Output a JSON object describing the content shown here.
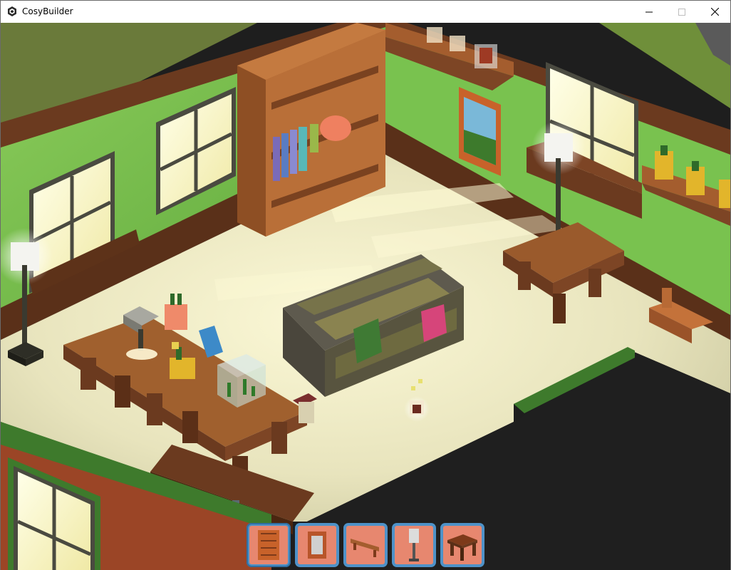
{
  "window": {
    "title": "CosyBuilder",
    "app_icon": "cube-icon",
    "controls": {
      "minimize": "minimize-icon",
      "maximize": "maximize-icon",
      "close": "close-icon"
    }
  },
  "scene": {
    "description_icons": [
      "room-isometric"
    ],
    "colors": {
      "wall_green": "#7fbf52",
      "wall_dark": "#3e7a2c",
      "floor": "#e9e6c2",
      "wood": "#8a4f2a",
      "wood_dark": "#5b2f17",
      "exterior_dark": "#1f1f1f",
      "brick": "#a14b2c"
    }
  },
  "hotbar": {
    "slots": [
      {
        "item": "bookshelf-icon",
        "selected": true
      },
      {
        "item": "picture-frame-icon",
        "selected": false
      },
      {
        "item": "wall-shelf-icon",
        "selected": false
      },
      {
        "item": "floor-lamp-icon",
        "selected": false
      },
      {
        "item": "side-table-icon",
        "selected": false
      }
    ],
    "colors": {
      "frame": "#4e92c8",
      "slot_bg": "#e7876f"
    }
  }
}
